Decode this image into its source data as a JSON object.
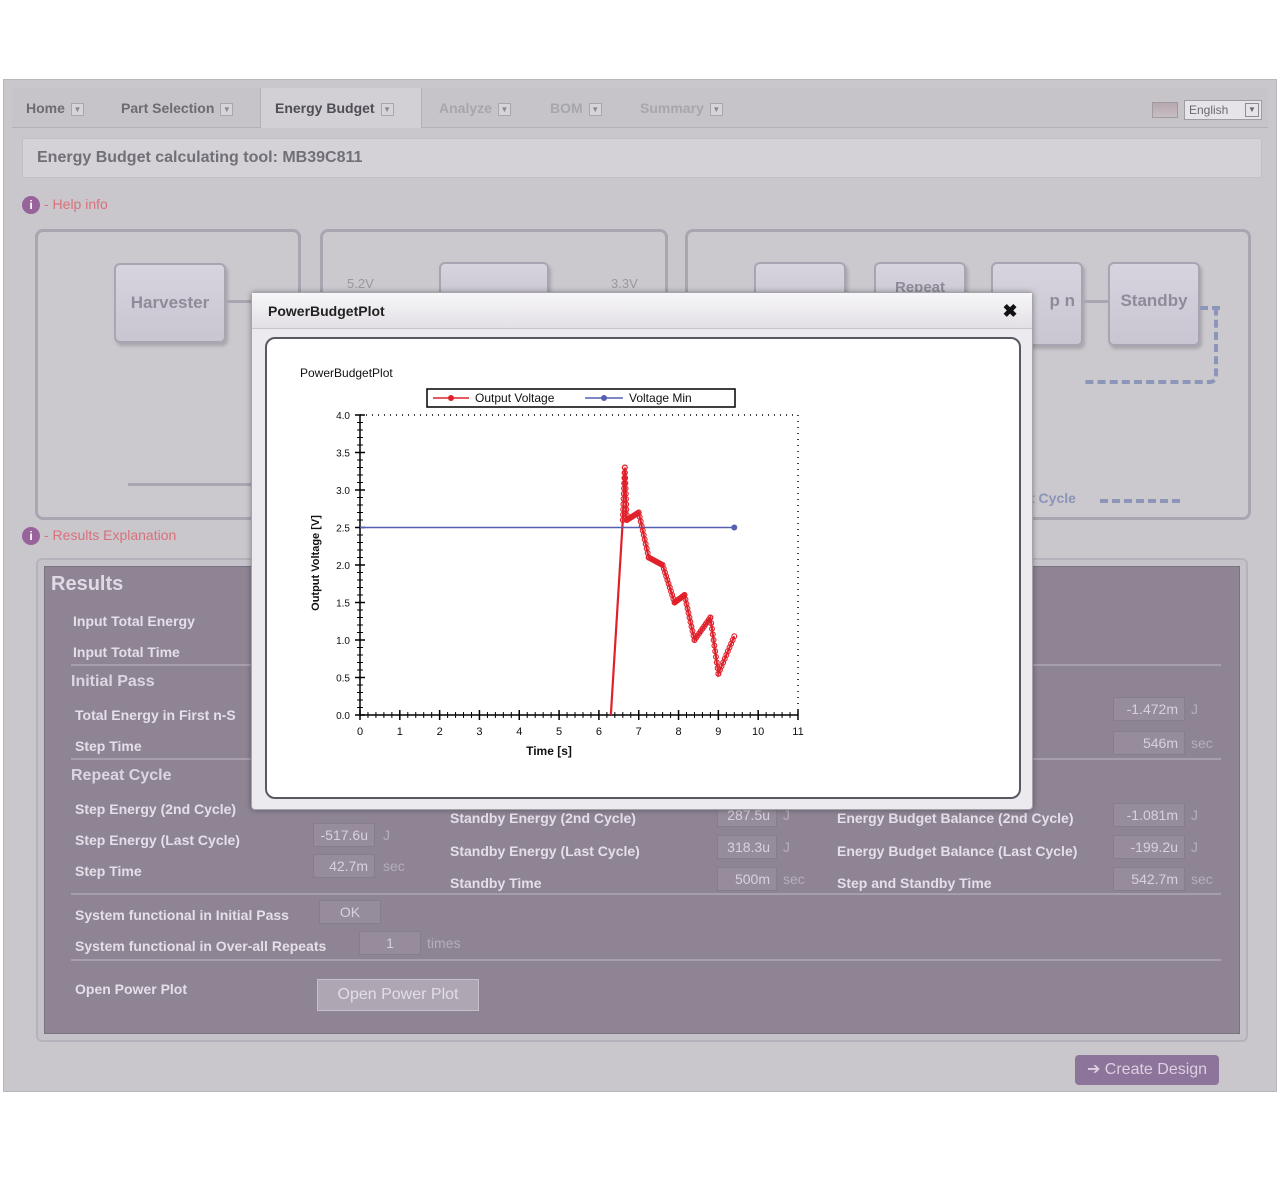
{
  "nav": {
    "tabs": [
      {
        "label": "Home"
      },
      {
        "label": "Part Selection"
      },
      {
        "label": "Energy Budget"
      },
      {
        "label": "Analyze"
      },
      {
        "label": "BOM"
      },
      {
        "label": "Summary"
      }
    ],
    "language": "English"
  },
  "page_title": "Energy Budget calculating tool: MB39C811",
  "help_info": "- Help info",
  "results_explanation": "- Results Explanation",
  "diagram": {
    "harvester": "Harvester",
    "v_in": "5.2V",
    "v_out": "3.3V",
    "repeat": "Repeat",
    "step_n": "p n",
    "standby": "Standby",
    "cycle": "t Cycle"
  },
  "results": {
    "title": "Results",
    "input_total_energy": "Input Total Energy",
    "input_total_time": "Input Total Time",
    "initial_pass": "Initial Pass",
    "total_energy_first": "Total Energy in First n-S",
    "step_time": "Step Time",
    "initial_right_value1": "-1.472m",
    "initial_right_unit1": "J",
    "initial_right_value2": "546m",
    "initial_right_unit2": "sec",
    "repeat_cycle": "Repeat Cycle",
    "step_energy_2nd": "Step Energy (2nd Cycle)",
    "step_energy_last": "Step Energy (Last Cycle)",
    "step_energy_last_value": "-517.6u",
    "step_time_repeat": "Step Time",
    "step_time_value": "42.7m",
    "unit_j": "J",
    "unit_sec": "sec",
    "standby_energy_2nd": "Standby Energy (2nd Cycle)",
    "standby_energy_2nd_value": "287.5u",
    "standby_energy_last": "Standby Energy (Last Cycle)",
    "standby_energy_last_value": "318.3u",
    "standby_time": "Standby Time",
    "standby_time_value": "500m",
    "budget_balance_2nd": "Energy Budget Balance (2nd Cycle)",
    "budget_balance_2nd_value": "-1.081m",
    "budget_balance_last": "Energy Budget Balance (Last Cycle)",
    "budget_balance_last_value": "-199.2u",
    "step_standby_time": "Step and Standby Time",
    "step_standby_time_value": "542.7m",
    "sys_initial": "System functional in Initial Pass",
    "sys_initial_value": "OK",
    "sys_repeats": "System functional in Over-all Repeats",
    "sys_repeats_value": "1",
    "times": "times",
    "open_plot_label": "Open Power Plot",
    "open_plot_button": "Open Power Plot"
  },
  "create_design": "➔ Create Design",
  "modal": {
    "title": "PowerBudgetPlot",
    "close": "✖"
  },
  "colors": {
    "output_voltage": "#e0202a",
    "voltage_min": "#5560b0"
  },
  "chart_data": {
    "type": "line",
    "title": "PowerBudgetPlot",
    "xlabel": "Time [s]",
    "ylabel": "Output Voltage [V]",
    "xlim": [
      0,
      11
    ],
    "ylim": [
      0,
      4.0
    ],
    "x_ticks": [
      "0",
      "1",
      "2",
      "3",
      "4",
      "5",
      "6",
      "7",
      "8",
      "9",
      "10",
      "11"
    ],
    "y_ticks": [
      "0.0",
      "0.5",
      "1.0",
      "1.5",
      "2.0",
      "2.5",
      "3.0",
      "3.5",
      "4.0"
    ],
    "legend": "top",
    "series": [
      {
        "name": "Output Voltage",
        "points": [
          [
            6.3,
            0.0
          ],
          [
            6.6,
            2.6
          ],
          [
            6.65,
            3.3
          ],
          [
            6.7,
            2.6
          ],
          [
            7.0,
            2.7
          ],
          [
            7.25,
            2.1
          ],
          [
            7.6,
            2.0
          ],
          [
            7.9,
            1.5
          ],
          [
            8.15,
            1.6
          ],
          [
            8.4,
            1.0
          ],
          [
            8.8,
            1.3
          ],
          [
            9.0,
            0.55
          ],
          [
            9.4,
            1.05
          ]
        ]
      },
      {
        "name": "Voltage Min",
        "points": [
          [
            0,
            2.5
          ],
          [
            9.4,
            2.5
          ]
        ]
      }
    ]
  }
}
